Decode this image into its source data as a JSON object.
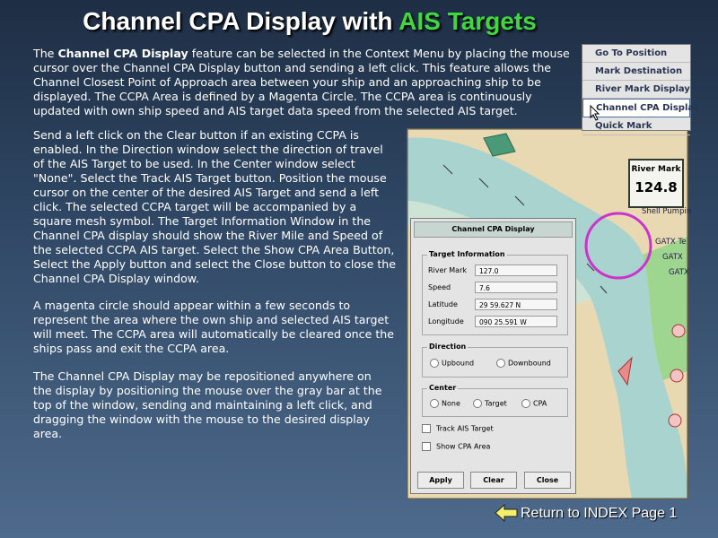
{
  "title": {
    "prefix": "Channel CPA Display with",
    "highlight": "AIS Targets"
  },
  "paragraphs": {
    "p1_pre": "The ",
    "p1_bold": "Channel CPA Display",
    "p1_post": " feature can be selected in the Context Menu by placing the  mouse cursor over the Channel CPA Display button and sending a left click. This feature allows the Channel Closest Point of Approach area between your ship and an approaching ship to be displayed.  The CCPA Area is defined by a Magenta Circle.  The CCPA area is continuously updated with own ship speed and AIS target data speed from the selected AIS target.",
    "p2": "Send a left click on the Clear button if an existing CCPA is enabled.  In the Direction window select the direction of  travel of the AIS Target to be used.  In the Center window select \"None\".  Select the Track AIS Target button.  Position the mouse cursor on the center of the desired AIS Target and send a left click. The selected CCPA target will be accompanied by a square mesh symbol. The Target Information Window in the Channel CPA display should show the River Mile and Speed of the selected CCPA AIS target.  Select the Show CPA Area Button, Select the Apply button and select the Close button to close the Channel CPA Display window.",
    "p3": "A magenta circle should appear within a few seconds to represent the area where the own ship and selected AIS target will meet.   The CCPA area will automatically be cleared once the ships pass and exit the CCPA area.",
    "p4": "The Channel CPA Display may be repositioned anywhere on the display by positioning the mouse over the gray bar at the top of the window, sending and maintaining a left click, and dragging the window with the mouse to the desired display area."
  },
  "context_menu": {
    "items": [
      "Go To Position",
      "Mark Destination",
      "River Mark Display",
      "Channel CPA Display",
      "Quick Mark"
    ]
  },
  "map": {
    "river_mark_label": "River Mark",
    "river_mark_value": "124.8",
    "labels": [
      "Shell Pumpin",
      "GATX Te",
      "GATX",
      "GATX"
    ]
  },
  "dialog": {
    "title": "Channel CPA Display",
    "target_info": {
      "label": "Target Information",
      "river_mark_label": "River Mark",
      "river_mark_value": "127.0",
      "speed_label": "Speed",
      "speed_value": "7.6",
      "latitude_label": "Latitude",
      "latitude_value": "29 59.627 N",
      "longitude_label": "Longitude",
      "longitude_value": "090 25.591 W"
    },
    "direction": {
      "label": "Direction",
      "upbound": "Upbound",
      "downbound": "Downbound"
    },
    "center": {
      "label": "Center",
      "none": "None",
      "target": "Target",
      "cpa": "CPA"
    },
    "track_ais_target": "Track AIS Target",
    "show_cpa_area": "Show CPA Area",
    "buttons": {
      "apply": "Apply",
      "clear": "Clear",
      "close": "Close"
    }
  },
  "footer": {
    "return_link": "Return to INDEX Page 1"
  },
  "colors": {
    "title_green": "#3fd83f",
    "cpa_circle": "#cc33cc",
    "river": "#a9d3cf"
  }
}
